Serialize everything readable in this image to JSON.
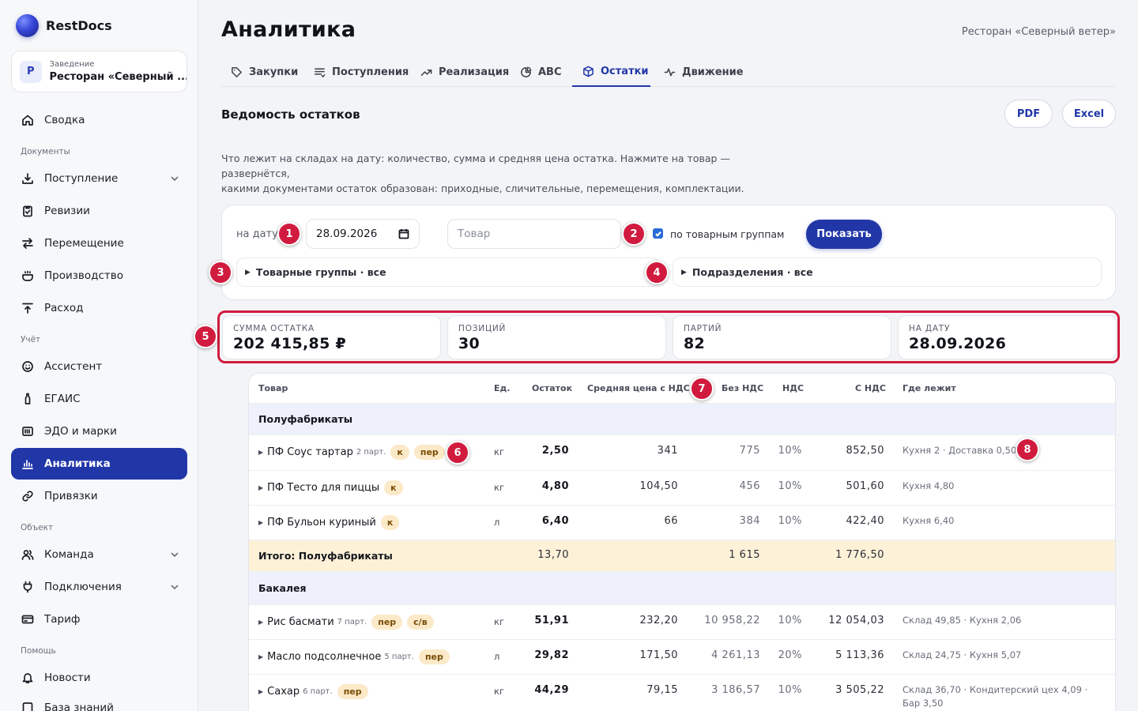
{
  "brand": {
    "name": "RestDocs"
  },
  "venue_card": {
    "avatar": "Р",
    "label": "Заведение",
    "name": "Ресторан «Северный ..."
  },
  "nav": {
    "summary": "Сводка",
    "section_documents": "Документы",
    "receipts": "Поступление",
    "audits": "Ревизии",
    "transfers": "Перемещение",
    "production": "Производство",
    "expense": "Расход",
    "section_accounting": "Учёт",
    "assistant": "Ассистент",
    "egais": "ЕГАИС",
    "edo": "ЭДО и марки",
    "analytics": "Аналитика",
    "bindings": "Привязки",
    "section_object": "Объект",
    "team": "Команда",
    "connections": "Подключения",
    "tariff": "Тариф",
    "section_help": "Помощь",
    "news": "Новости",
    "knowledge": "База знаний"
  },
  "header": {
    "title": "Аналитика",
    "venue": "Ресторан «Северный ветер»",
    "tabs": [
      "Закупки",
      "Поступления",
      "Реализация",
      "ABC",
      "Остатки",
      "Движение"
    ]
  },
  "section": {
    "title": "Ведомость остатков",
    "pdf": "PDF",
    "excel": "Excel",
    "desc_line1": "Что лежит на складах на дату: количество, сумма и средняя цена остатка. Нажмите на товар — развернётся,",
    "desc_line2": "какими документами остаток образован: приходные, сличительные, перемещения, комплектации."
  },
  "filters": {
    "date_label": "на дату",
    "date_value": "28.09.2026",
    "product_placeholder": "Товар",
    "by_groups": "по товарным группам",
    "show": "Показать",
    "groups": "Товарные группы · все",
    "departments": "Подразделения · все"
  },
  "kpi": [
    {
      "label": "СУММА ОСТАТКА",
      "value": "202 415,85 ₽"
    },
    {
      "label": "ПОЗИЦИЙ",
      "value": "30"
    },
    {
      "label": "ПАРТИЙ",
      "value": "82"
    },
    {
      "label": "НА ДАТУ",
      "value": "28.09.2026"
    }
  ],
  "table": {
    "headers": [
      "Товар",
      "Ед.",
      "Остаток",
      "Средняя цена с НДС",
      "Без НДС",
      "НДС",
      "С НДС",
      "Где лежит"
    ],
    "groups": [
      {
        "title": "Полуфабрикаты",
        "rows": [
          {
            "name": "ПФ Соус тартар",
            "batches": "2 парт.",
            "tags": [
              "к",
              "пер"
            ],
            "unit": "кг",
            "qty": "2,50",
            "avg": "341",
            "net": "775",
            "vat": "10%",
            "gross": "852,50",
            "where": "Кухня 2 · Доставка 0,50"
          },
          {
            "name": "ПФ Тесто для пиццы",
            "batches": "",
            "tags": [
              "к"
            ],
            "unit": "кг",
            "qty": "4,80",
            "avg": "104,50",
            "net": "456",
            "vat": "10%",
            "gross": "501,60",
            "where": "Кухня 4,80"
          },
          {
            "name": "ПФ Бульон куриный",
            "batches": "",
            "tags": [
              "к"
            ],
            "unit": "л",
            "qty": "6,40",
            "avg": "66",
            "net": "384",
            "vat": "10%",
            "gross": "422,40",
            "where": "Кухня 6,40"
          }
        ],
        "total": {
          "label": "Итого: Полуфабрикаты",
          "qty": "13,70",
          "net": "1 615",
          "gross": "1 776,50"
        }
      },
      {
        "title": "Бакалея",
        "rows": [
          {
            "name": "Рис басмати",
            "batches": "7 парт.",
            "tags": [
              "пер",
              "с/в"
            ],
            "unit": "кг",
            "qty": "51,91",
            "avg": "232,20",
            "net": "10 958,22",
            "vat": "10%",
            "gross": "12 054,03",
            "where": "Склад 49,85 · Кухня 2,06"
          },
          {
            "name": "Масло подсолнечное",
            "batches": "5 парт.",
            "tags": [
              "пер"
            ],
            "unit": "л",
            "qty": "29,82",
            "avg": "171,50",
            "net": "4 261,13",
            "vat": "20%",
            "gross": "5 113,36",
            "where": "Склад 24,75 · Кухня 5,07"
          },
          {
            "name": "Сахар",
            "batches": "6 парт.",
            "tags": [
              "пер"
            ],
            "unit": "кг",
            "qty": "44,29",
            "avg": "79,15",
            "net": "3 186,57",
            "vat": "10%",
            "gross": "3 505,22",
            "where": "Склад 36,70 · Кондитерский цех 4,09 · Бар 3,50"
          }
        ]
      }
    ]
  },
  "markers": [
    "1",
    "2",
    "3",
    "4",
    "5",
    "6",
    "7",
    "8"
  ],
  "colors": {
    "accent": "#2137a8",
    "marker": "#d11b3e",
    "tag_bg": "#fbe9c8",
    "group_bg": "#eef1fb",
    "total_bg": "#fdf1d8"
  }
}
